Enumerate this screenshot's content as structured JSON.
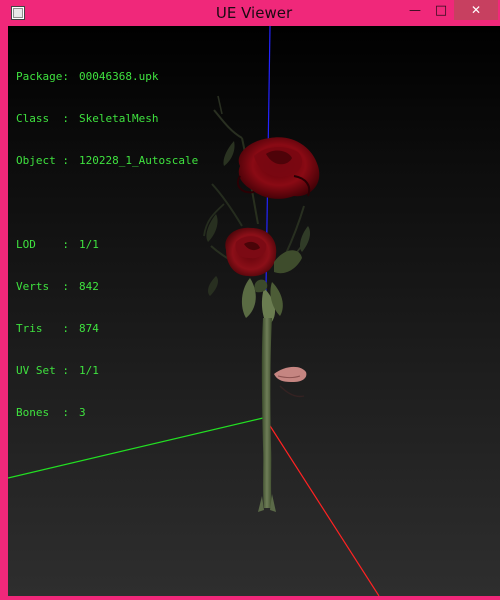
{
  "window": {
    "title": "UE Viewer",
    "minimize_glyph": "—",
    "maximize_glyph": "□",
    "close_glyph": "✕",
    "accent_color": "#f0287a",
    "close_color": "#c74060"
  },
  "info_panel": {
    "color": "#3fe23f",
    "package": {
      "label": "Package:",
      "value": "00046368.upk"
    },
    "class": {
      "label": "Class  :",
      "value": "SkeletalMesh"
    },
    "object": {
      "label": "Object :",
      "value": "120228_1_Autoscale"
    },
    "lod": {
      "label": "LOD    :",
      "value": "1/1"
    },
    "verts": {
      "label": "Verts  :",
      "value": "842"
    },
    "tris": {
      "label": "Tris   :",
      "value": "874"
    },
    "uvset": {
      "label": "UV Set :",
      "value": "1/1"
    },
    "bones": {
      "label": "Bones  :",
      "value": "3"
    }
  },
  "scene": {
    "model": "red rose with stem",
    "axis_colors": {
      "x": "#ff2020",
      "y": "#20e020",
      "z": "#2020ff"
    }
  }
}
